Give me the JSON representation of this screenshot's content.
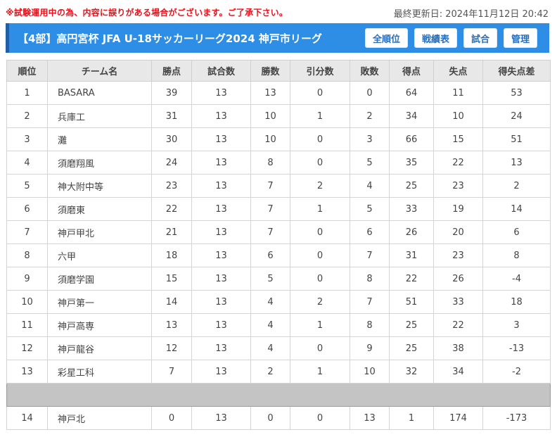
{
  "notice": "※試験運用中の為、内容に誤りがある場合がございます。ご了承下さい。",
  "last_updated": "最終更新日: 2024年11月12日 20:42",
  "header": {
    "title": "【4部】高円宮杯 JFA U-18サッカーリーグ2024 神戸市リーグ",
    "nav": [
      "全順位",
      "戦績表",
      "試合",
      "管理"
    ]
  },
  "table": {
    "headers": [
      "順位",
      "チーム名",
      "勝点",
      "試合数",
      "勝数",
      "引分数",
      "敗数",
      "得点",
      "失点",
      "得失点差"
    ],
    "rows": [
      [
        "1",
        "BASARA",
        "39",
        "13",
        "13",
        "0",
        "0",
        "64",
        "11",
        "53"
      ],
      [
        "2",
        "兵庫工",
        "31",
        "13",
        "10",
        "1",
        "2",
        "34",
        "10",
        "24"
      ],
      [
        "3",
        "灘",
        "30",
        "13",
        "10",
        "0",
        "3",
        "66",
        "15",
        "51"
      ],
      [
        "4",
        "須磨翔風",
        "24",
        "13",
        "8",
        "0",
        "5",
        "35",
        "22",
        "13"
      ],
      [
        "5",
        "神大附中等",
        "23",
        "13",
        "7",
        "2",
        "4",
        "25",
        "23",
        "2"
      ],
      [
        "6",
        "須磨東",
        "22",
        "13",
        "7",
        "1",
        "5",
        "33",
        "19",
        "14"
      ],
      [
        "7",
        "神戸甲北",
        "21",
        "13",
        "7",
        "0",
        "6",
        "26",
        "20",
        "6"
      ],
      [
        "8",
        "六甲",
        "18",
        "13",
        "6",
        "0",
        "7",
        "31",
        "23",
        "8"
      ],
      [
        "9",
        "須磨学園",
        "15",
        "13",
        "5",
        "0",
        "8",
        "22",
        "26",
        "-4"
      ],
      [
        "10",
        "神戸第一",
        "14",
        "13",
        "4",
        "2",
        "7",
        "51",
        "33",
        "18"
      ],
      [
        "11",
        "神戸高専",
        "13",
        "13",
        "4",
        "1",
        "8",
        "25",
        "22",
        "3"
      ],
      [
        "12",
        "神戸龍谷",
        "12",
        "13",
        "4",
        "0",
        "9",
        "25",
        "38",
        "-13"
      ],
      [
        "13",
        "彩星工科",
        "7",
        "13",
        "2",
        "1",
        "10",
        "32",
        "34",
        "-2"
      ]
    ],
    "relegated_rows": [
      [
        "14",
        "神戸北",
        "0",
        "13",
        "0",
        "0",
        "13",
        "1",
        "174",
        "-173"
      ]
    ]
  },
  "colors": {
    "notice_red": "#e8121c",
    "header_blue": "#2e8ee6",
    "header_accent": "#1f5fa8",
    "separator_gray": "#c4c4c4"
  }
}
